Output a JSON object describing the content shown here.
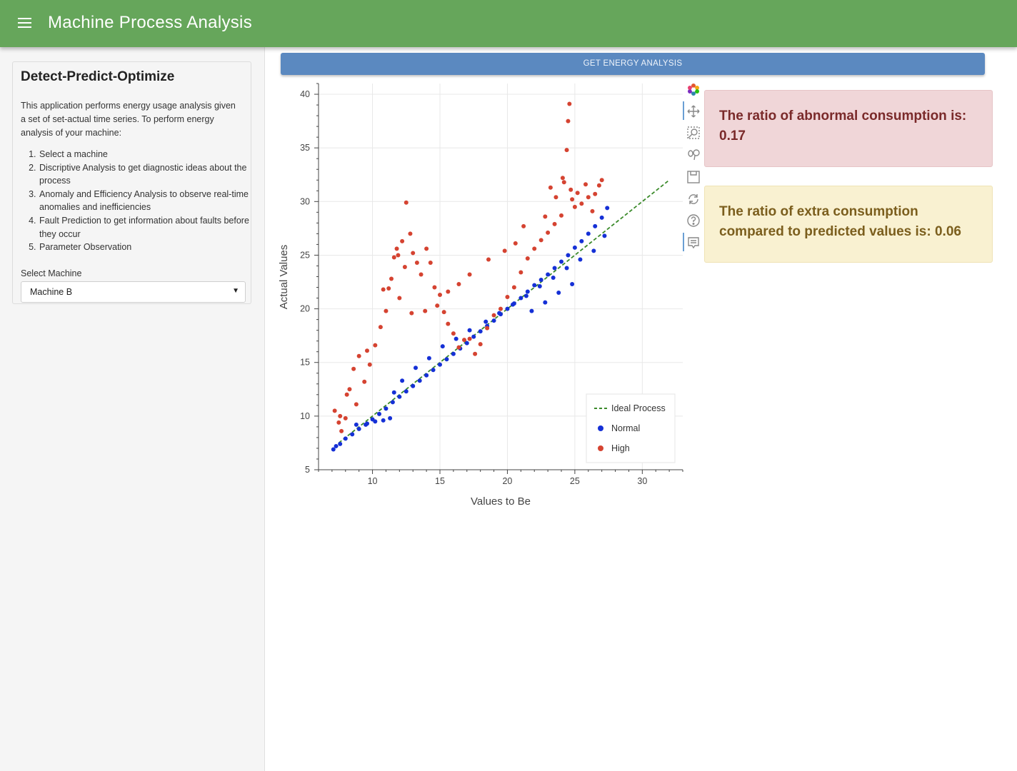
{
  "header": {
    "title": "Machine Process Analysis",
    "menu_icon": "hamburger-menu-icon",
    "color": "#66a65b"
  },
  "sidebar": {
    "heading": "Detect-Predict-Optimize",
    "description": "This application performs energy usage analysis given a set of set-actual time series. To perform energy analysis of your machine:",
    "steps": [
      "Select a machine",
      "Discriptive Analysis to get diagnostic ideas about the process",
      "Anomaly and Efficiency Analysis to observe real-time anomalies and inefficiencies",
      "Fault Prediction to get information about faults before they occur",
      "Parameter Observation"
    ],
    "select_label": "Select Machine",
    "select_value": "Machine B"
  },
  "main": {
    "button_label": "GET ENERGY ANALYSIS",
    "button_color": "#5b89c0",
    "alerts": [
      {
        "text": "The ratio of abnormal consumption is: 0.17",
        "kind": "danger",
        "color": "#f0d6d8"
      },
      {
        "text": "The ratio of extra consumption compared to predicted values is: 0.06",
        "kind": "warning",
        "color": "#f9f1d1"
      }
    ],
    "toolbar": [
      "bokeh-logo-icon",
      "pan-icon",
      "box-zoom-icon",
      "wheel-zoom-icon",
      "save-icon",
      "reset-icon",
      "help-icon",
      "hover-icon"
    ]
  },
  "chart_data": {
    "type": "scatter",
    "xlabel": "Values to Be",
    "ylabel": "Actual Values",
    "xlim": [
      6,
      33
    ],
    "ylim": [
      5,
      41
    ],
    "xticks": [
      10,
      15,
      20,
      25,
      30
    ],
    "yticks": [
      5,
      10,
      15,
      20,
      25,
      30,
      35,
      40
    ],
    "grid": true,
    "legend_position": "bottom-right",
    "series": [
      {
        "name": "Ideal Process",
        "kind": "line",
        "style": "dashed",
        "color": "#3a8a2a",
        "x": [
          7.5,
          32
        ],
        "y": [
          7.5,
          32
        ]
      },
      {
        "name": "Normal",
        "kind": "scatter",
        "color": "#1530d6",
        "x": [
          7.1,
          7.3,
          7.6,
          8.0,
          8.5,
          9.0,
          9.5,
          10.0,
          10.5,
          11.0,
          11.5,
          12.0,
          12.5,
          13.0,
          13.5,
          14.0,
          14.5,
          15.0,
          15.5,
          16.0,
          16.5,
          17.0,
          17.5,
          18.0,
          18.5,
          19.0,
          19.5,
          20.0,
          20.5,
          21.0,
          21.5,
          22.0,
          22.5,
          23.0,
          23.5,
          24.0,
          24.5,
          25.0,
          25.5,
          26.0,
          26.5,
          27.0,
          27.4,
          8.8,
          9.6,
          10.2,
          10.8,
          11.3,
          11.6,
          12.2,
          13.2,
          14.2,
          15.2,
          16.2,
          17.2,
          18.4,
          19.4,
          20.4,
          21.4,
          22.4,
          23.4,
          24.4,
          25.4,
          26.4,
          27.2,
          21.8,
          22.8,
          23.8,
          24.8
        ],
        "y": [
          6.9,
          7.2,
          7.4,
          7.9,
          8.3,
          8.8,
          9.2,
          9.7,
          10.2,
          10.7,
          11.3,
          11.8,
          12.3,
          12.8,
          13.3,
          13.8,
          14.3,
          14.8,
          15.3,
          15.8,
          16.3,
          16.8,
          17.4,
          17.9,
          18.4,
          18.9,
          19.5,
          20.0,
          20.5,
          21.0,
          21.6,
          22.2,
          22.7,
          23.2,
          23.8,
          24.4,
          25.0,
          25.7,
          26.3,
          27.0,
          27.7,
          28.5,
          29.4,
          9.2,
          9.3,
          9.5,
          9.6,
          9.8,
          12.2,
          13.3,
          14.5,
          15.4,
          16.5,
          17.2,
          18.0,
          18.8,
          19.6,
          20.4,
          21.2,
          22.1,
          22.9,
          23.8,
          24.6,
          25.4,
          26.8,
          19.8,
          20.6,
          21.5,
          22.3
        ]
      },
      {
        "name": "High",
        "kind": "scatter",
        "color": "#d54331",
        "x": [
          7.2,
          7.5,
          7.7,
          8.0,
          8.3,
          8.6,
          9.0,
          9.4,
          9.8,
          10.2,
          10.6,
          11.0,
          11.2,
          11.4,
          11.6,
          11.8,
          12.0,
          12.2,
          12.5,
          12.8,
          13.0,
          13.3,
          13.6,
          14.0,
          14.3,
          14.6,
          15.0,
          15.3,
          15.6,
          16.0,
          16.4,
          16.8,
          17.2,
          17.6,
          18.0,
          18.5,
          19.0,
          19.5,
          20.0,
          20.5,
          21.0,
          21.5,
          22.0,
          22.5,
          23.0,
          23.5,
          24.0,
          24.2,
          24.4,
          24.5,
          24.6,
          24.8,
          25.0,
          25.5,
          26.0,
          26.5,
          26.8,
          27.0,
          23.2,
          23.6,
          24.1,
          24.7,
          25.2,
          25.8,
          26.3,
          22.8,
          21.2,
          20.6,
          19.8,
          18.6,
          17.2,
          16.4,
          15.6,
          14.8,
          13.9,
          12.9,
          12.4,
          11.9,
          10.8,
          9.6,
          8.8,
          8.1,
          7.6
        ],
        "y": [
          10.5,
          9.4,
          8.6,
          9.8,
          12.5,
          14.4,
          15.6,
          13.2,
          14.8,
          16.6,
          18.3,
          19.8,
          21.9,
          22.8,
          24.8,
          25.6,
          21.0,
          26.3,
          29.9,
          27.0,
          25.2,
          24.3,
          23.2,
          25.6,
          24.3,
          22.0,
          21.3,
          19.7,
          18.6,
          17.7,
          16.4,
          17.1,
          17.2,
          15.8,
          16.7,
          18.2,
          19.4,
          20.0,
          21.1,
          22.0,
          23.4,
          24.7,
          25.6,
          26.4,
          27.1,
          27.9,
          28.7,
          31.8,
          34.8,
          37.5,
          39.1,
          30.2,
          29.5,
          29.8,
          30.4,
          30.7,
          31.5,
          32.0,
          31.3,
          30.4,
          32.2,
          31.1,
          30.8,
          31.6,
          29.1,
          28.6,
          27.7,
          26.1,
          25.4,
          24.6,
          23.2,
          22.3,
          21.6,
          20.3,
          19.8,
          19.6,
          23.9,
          25.0,
          21.8,
          16.1,
          11.1,
          12.0,
          10.0
        ]
      }
    ]
  }
}
